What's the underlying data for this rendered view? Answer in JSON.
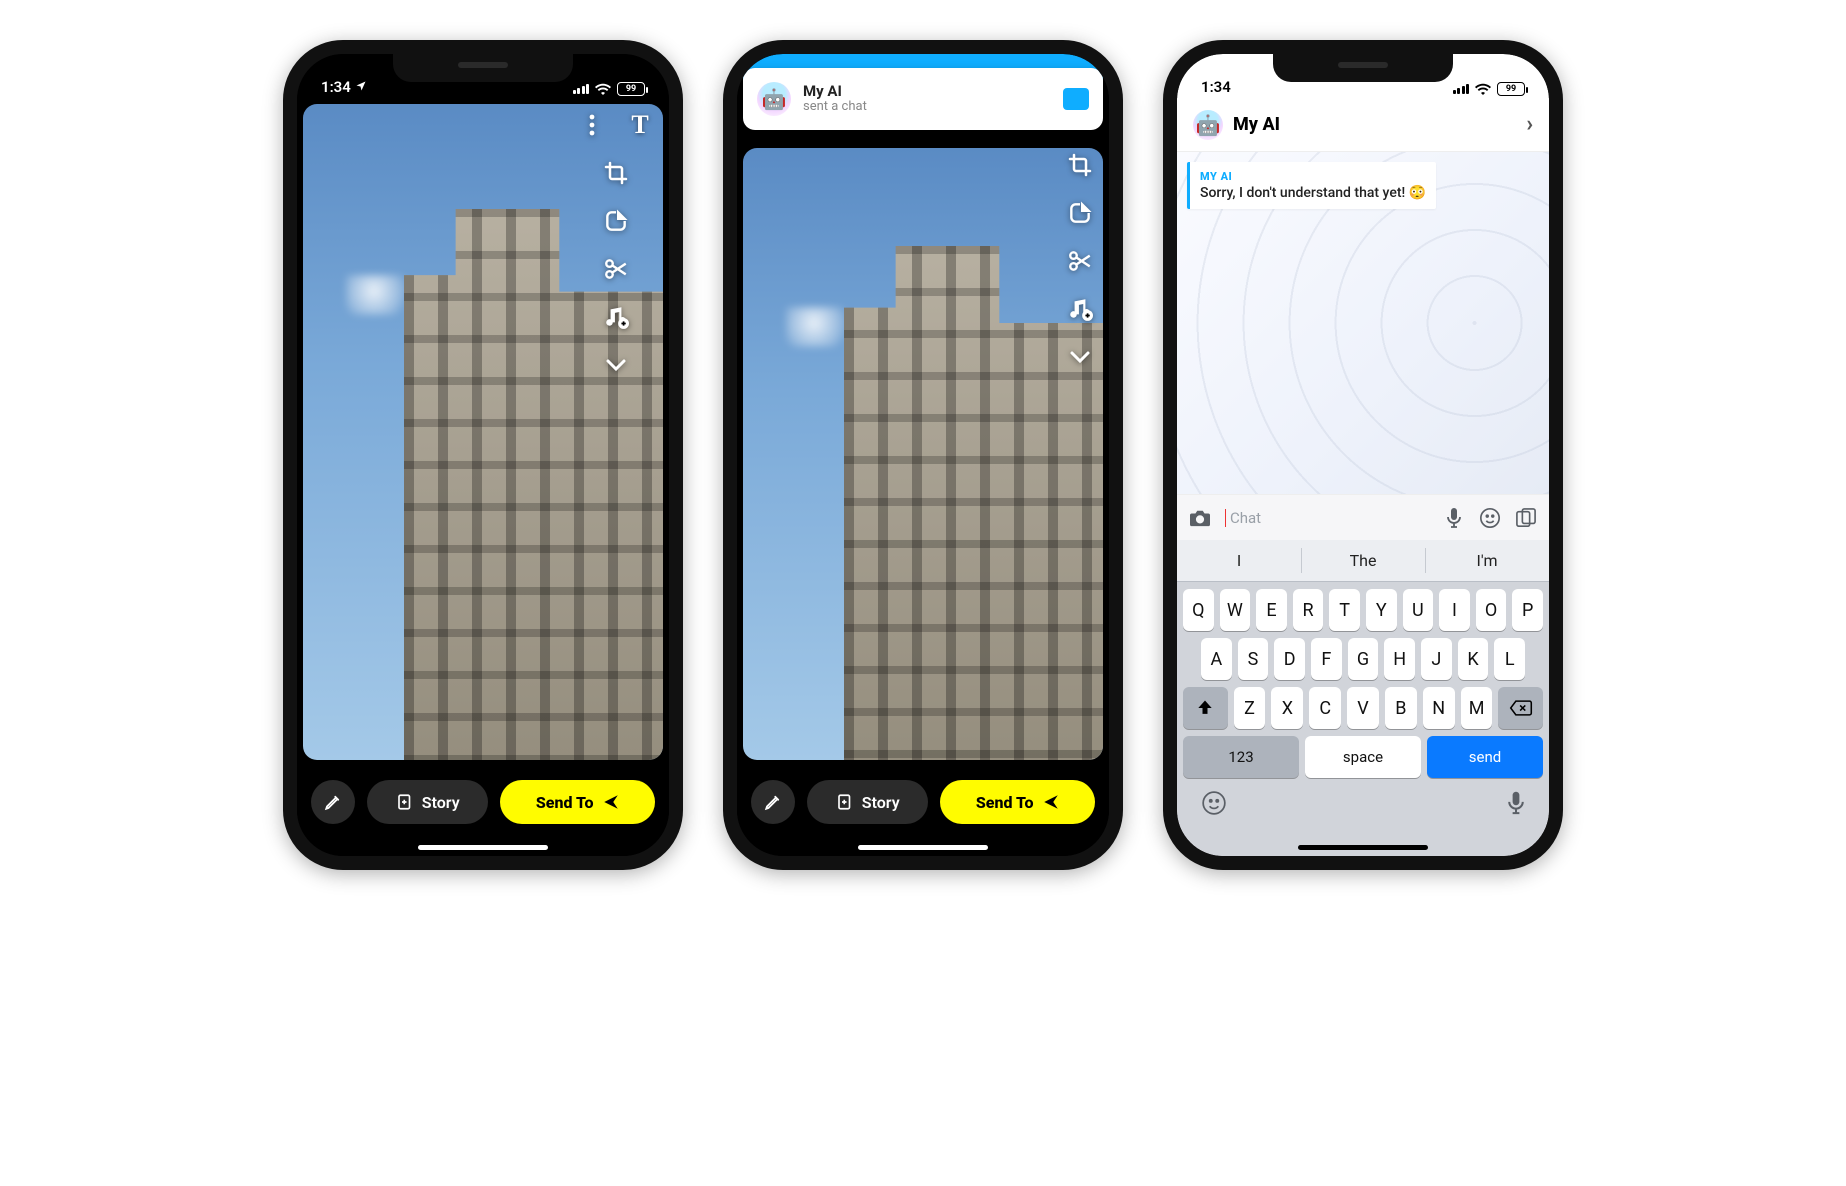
{
  "status_bar": {
    "time": "1:34",
    "location_arrow": true,
    "battery_percent": "99"
  },
  "camera_tools": {
    "more_icon": "more-vertical-icon",
    "text_label": "T",
    "crop_icon": "crop-icon",
    "sticker_icon": "sticker-icon",
    "scissors_icon": "scissors-icon",
    "music_icon": "music-add-icon",
    "expand_icon": "chevron-down-icon"
  },
  "bottom": {
    "save_icon": "pencil-icon",
    "story_icon": "story-add-icon",
    "story_label": "Story",
    "send_label": "Send To",
    "send_icon": "send-arrow-icon"
  },
  "banner": {
    "title": "My AI",
    "subtitle": "sent a chat",
    "icon": "chat-filled-icon"
  },
  "chat": {
    "title": "My AI",
    "sender": "MY AI",
    "message": "Sorry, I don't understand that yet! 😳",
    "input_placeholder": "Chat"
  },
  "keyboard": {
    "suggestions": [
      "I",
      "The",
      "I'm"
    ],
    "row1": [
      "Q",
      "W",
      "E",
      "R",
      "T",
      "Y",
      "U",
      "I",
      "O",
      "P"
    ],
    "row2": [
      "A",
      "S",
      "D",
      "F",
      "G",
      "H",
      "J",
      "K",
      "L"
    ],
    "row3": [
      "Z",
      "X",
      "C",
      "V",
      "B",
      "N",
      "M"
    ],
    "shift_icon": "shift-icon",
    "backspace_icon": "backspace-icon",
    "num_label": "123",
    "space_label": "space",
    "send_label": "send",
    "emoji_icon": "emoji-icon",
    "mic_icon": "mic-icon"
  }
}
